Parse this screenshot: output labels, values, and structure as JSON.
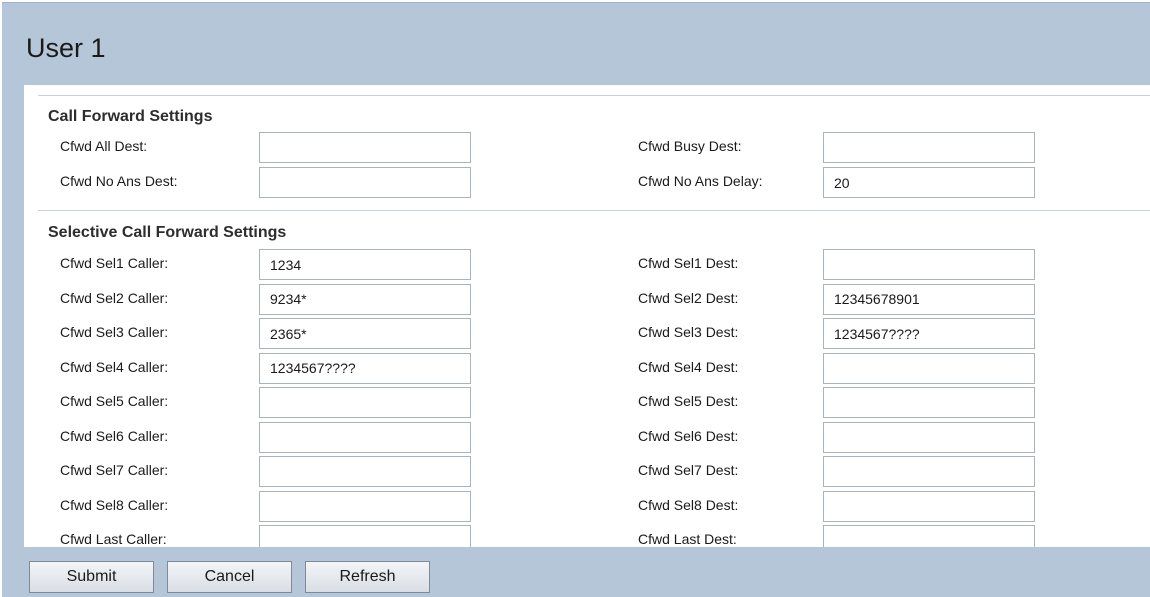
{
  "page": {
    "title": "User 1"
  },
  "call_forward": {
    "title": "Call Forward Settings",
    "fields": [
      {
        "label": "Cfwd All Dest:",
        "value": ""
      },
      {
        "label": "Cfwd Busy Dest:",
        "value": ""
      },
      {
        "label": "Cfwd No Ans Dest:",
        "value": ""
      },
      {
        "label": "Cfwd No Ans Delay:",
        "value": "20"
      }
    ]
  },
  "selective_forward": {
    "title": "Selective Call Forward Settings",
    "callers": [
      {
        "label": "Cfwd Sel1 Caller:",
        "value": "1234"
      },
      {
        "label": "Cfwd Sel2 Caller:",
        "value": "9234*"
      },
      {
        "label": "Cfwd Sel3 Caller:",
        "value": "2365*"
      },
      {
        "label": "Cfwd Sel4 Caller:",
        "value": "1234567????"
      },
      {
        "label": "Cfwd Sel5 Caller:",
        "value": ""
      },
      {
        "label": "Cfwd Sel6 Caller:",
        "value": ""
      },
      {
        "label": "Cfwd Sel7 Caller:",
        "value": ""
      },
      {
        "label": "Cfwd Sel8 Caller:",
        "value": ""
      },
      {
        "label": "Cfwd Last Caller:",
        "value": ""
      }
    ],
    "dests": [
      {
        "label": "Cfwd Sel1 Dest:",
        "value": ""
      },
      {
        "label": "Cfwd Sel2 Dest:",
        "value": "12345678901"
      },
      {
        "label": "Cfwd Sel3 Dest:",
        "value": "1234567????"
      },
      {
        "label": "Cfwd Sel4 Dest:",
        "value": ""
      },
      {
        "label": "Cfwd Sel5 Dest:",
        "value": ""
      },
      {
        "label": "Cfwd Sel6 Dest:",
        "value": ""
      },
      {
        "label": "Cfwd Sel7 Dest:",
        "value": ""
      },
      {
        "label": "Cfwd Sel8 Dest:",
        "value": ""
      },
      {
        "label": "Cfwd Last Dest:",
        "value": ""
      }
    ]
  },
  "footer": {
    "submit_label": "Submit",
    "cancel_label": "Cancel",
    "refresh_label": "Refresh"
  },
  "colors": {
    "frame_blue": "#b6c6d9",
    "divider": "#c9d2dc",
    "input_border": "#a9b3bd"
  }
}
